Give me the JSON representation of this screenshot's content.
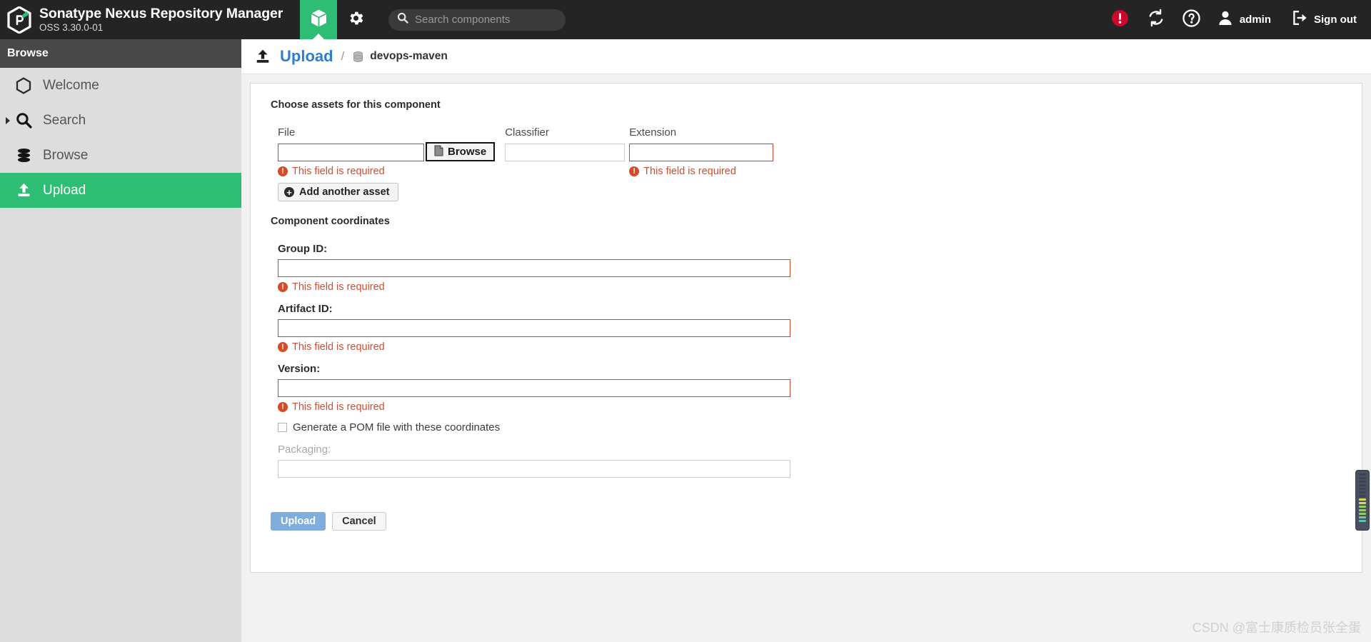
{
  "header": {
    "brand_title": "Sonatype Nexus Repository Manager",
    "brand_version": "OSS 3.30.0-01",
    "logo_icon": "nexus-hexagon-logo-icon",
    "browse_tab_icon": "cube-icon",
    "admin_tab_icon": "gear-icon",
    "search": {
      "placeholder": "Search components",
      "value": "",
      "icon": "search-icon"
    },
    "alert_icon": "alert-exclamation-icon",
    "refresh_icon": "refresh-sync-icon",
    "help_icon": "question-help-icon",
    "user_icon": "user-avatar-icon",
    "user_label": "admin",
    "signout_icon": "sign-out-icon",
    "signout_label": "Sign out",
    "accent_green": "#2dbd73",
    "alert_red": "#c9082c",
    "bar_background": "#242424"
  },
  "sidebar": {
    "title": "Browse",
    "items": [
      {
        "label": "Welcome",
        "icon": "hexagon-outline-icon",
        "active": false,
        "caret": false
      },
      {
        "label": "Search",
        "icon": "search-icon",
        "active": false,
        "caret": true
      },
      {
        "label": "Browse",
        "icon": "database-stack-icon",
        "active": false,
        "caret": false
      },
      {
        "label": "Upload",
        "icon": "upload-arrow-icon",
        "active": true,
        "caret": false
      }
    ]
  },
  "breadcrumb": {
    "icon": "upload-arrow-icon",
    "link": "Upload",
    "separator": "/",
    "repo_icon": "database-icon",
    "current": "devops-maven"
  },
  "form": {
    "assets_section_title": "Choose assets for this component",
    "asset_columns": [
      {
        "label": "File",
        "value": "",
        "error": "This field is required"
      },
      {
        "label": "Classifier",
        "value": "",
        "error": ""
      },
      {
        "label": "Extension",
        "value": "",
        "error": "This field is required"
      }
    ],
    "browse_button": {
      "label": "Browse",
      "icon": "file-document-icon"
    },
    "add_asset_button": {
      "label": "Add another asset",
      "icon": "plus-circle-icon"
    },
    "coordinates_section_title": "Component coordinates",
    "coordinates": [
      {
        "label": "Group ID:",
        "value": "",
        "error": "This field is required",
        "disabled": false
      },
      {
        "label": "Artifact ID:",
        "value": "",
        "error": "This field is required",
        "disabled": false
      },
      {
        "label": "Version:",
        "value": "",
        "error": "This field is required",
        "disabled": false
      }
    ],
    "pom_checkbox": {
      "label": "Generate a POM file with these coordinates",
      "checked": false
    },
    "packaging": {
      "label": "Packaging:",
      "value": "",
      "disabled": true
    },
    "upload_button": "Upload",
    "cancel_button": "Cancel",
    "error_color": "#cf4d31",
    "primary_button_color": "#7fadde"
  },
  "scroll_widget": {
    "name": "vertical-level-indicator",
    "bars": [
      "#3d4250",
      "#3d4250",
      "#3d4250",
      "#3d4250",
      "#3d4250",
      "#3d4250",
      "#3d4250",
      "#d6d96a",
      "#d6d96a",
      "#8fcf5a",
      "#8fcf5a",
      "#8fcf5a",
      "#6fc8a0",
      "#5bc4b4"
    ]
  },
  "watermark": "CSDN @富士康质检员张全蛋"
}
